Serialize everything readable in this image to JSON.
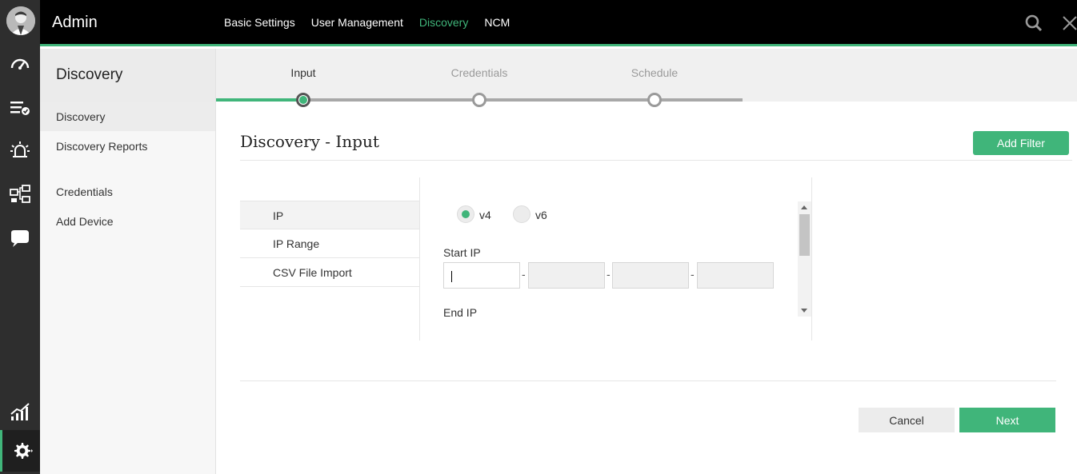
{
  "app": {
    "title": "Admin"
  },
  "topnav": [
    "Basic Settings",
    "User Management",
    "Discovery",
    "NCM"
  ],
  "topnav_active_index": 2,
  "rail_icons": [
    "avatar",
    "dashboard-icon",
    "inventory-icon",
    "alarm-icon",
    "network-map-icon",
    "chat-icon",
    "reports-icon",
    "settings-icon"
  ],
  "subnav": {
    "title": "Discovery",
    "items": [
      "Discovery",
      "Discovery Reports",
      "Credentials",
      "Add Device"
    ],
    "selected_index": 0
  },
  "wizard": {
    "steps": [
      "Input",
      "Credentials",
      "Schedule"
    ],
    "active_index": 0
  },
  "main": {
    "title": "Discovery - Input",
    "add_filter_label": "Add Filter",
    "methods": [
      "IP",
      "IP Range",
      "CSV File Import"
    ],
    "selected_method_index": 0,
    "ip_version": {
      "options": [
        "v4",
        "v6"
      ],
      "selected": "v4"
    },
    "start_ip_label": "Start IP",
    "start_ip_values": [
      "",
      "",
      "",
      ""
    ],
    "octet_separator": "-",
    "end_ip_label": "End IP"
  },
  "footer": {
    "cancel_label": "Cancel",
    "next_label": "Next"
  },
  "colors": {
    "accent": "#40b57a",
    "topbar": "#000000",
    "rail": "#2e2e2e"
  }
}
